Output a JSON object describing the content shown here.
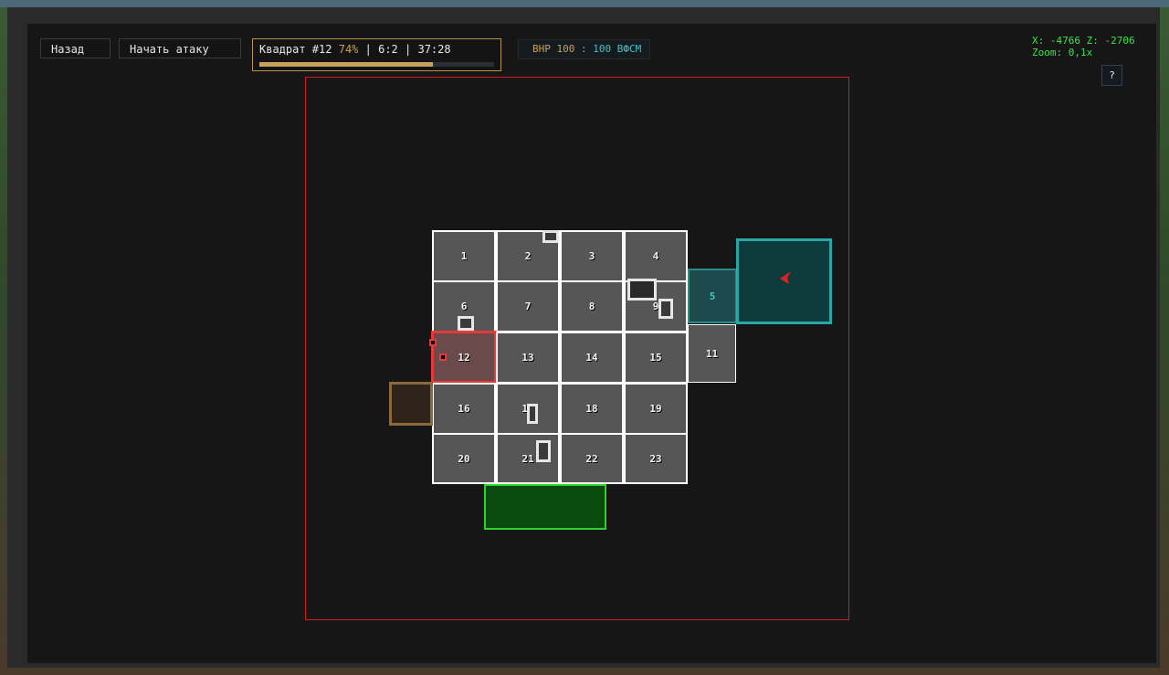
{
  "header": {
    "back_label": "Назад",
    "attack_label": "Начать атаку",
    "square_title": "Квадрат #12",
    "square_percent": "74%",
    "square_sep1": " | ",
    "square_coords": "6:2",
    "square_sep2": " | ",
    "square_timer": "37:28",
    "progress_value": 0.74,
    "bhp_left": "ВНР 100",
    "bhp_sep": " : ",
    "bhp_right": "100 ВФСМ",
    "coords_line1": "X: -4766 Z: -2706",
    "coords_line2": "Zoom: 0,1x",
    "help_label": "?"
  },
  "grid": {
    "cells": [
      {
        "label": "1"
      },
      {
        "label": "2"
      },
      {
        "label": "3"
      },
      {
        "label": "4"
      },
      {
        "label": "6"
      },
      {
        "label": "7"
      },
      {
        "label": "8"
      },
      {
        "label": "9"
      },
      {
        "label": "12"
      },
      {
        "label": "13"
      },
      {
        "label": "14"
      },
      {
        "label": "15"
      },
      {
        "label": "16"
      },
      {
        "label": "17"
      },
      {
        "label": "18"
      },
      {
        "label": "19"
      },
      {
        "label": "20"
      },
      {
        "label": "21"
      },
      {
        "label": "22"
      },
      {
        "label": "23"
      }
    ],
    "cell5_label": "5",
    "cell11_label": "11",
    "selected_label": "12"
  },
  "colors": {
    "accent_gold": "#c8a15c",
    "teal": "#3fc4c4",
    "frame_red": "#d21e1e",
    "coords_green": "#37e54a"
  }
}
